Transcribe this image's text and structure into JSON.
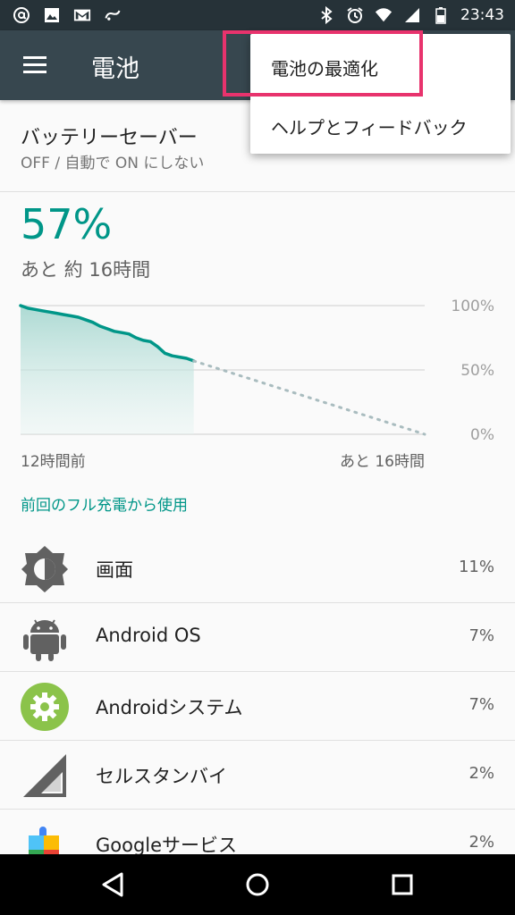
{
  "status_bar": {
    "time": "23:43",
    "left_icons": [
      "at-sign-icon",
      "image-icon",
      "gmail-icon",
      "voicemail-icon"
    ],
    "right_icons": [
      "bluetooth-icon",
      "alarm-icon",
      "wifi-icon",
      "signal-icon",
      "battery-icon"
    ]
  },
  "toolbar": {
    "title": "電池",
    "menu_icon": "hamburger-menu-icon",
    "background": "#37474f"
  },
  "overflow_menu": {
    "items": [
      {
        "label": "電池の最適化",
        "highlighted": true
      },
      {
        "label": "ヘルプとフィードバック"
      }
    ],
    "highlight_color": "#e8336d"
  },
  "battery_saver": {
    "title": "バッテリーセーバー",
    "subtitle": "OFF / 自動で ON にしない"
  },
  "battery": {
    "percent": "57%",
    "remaining": "あと 約 16時間"
  },
  "chart_data": {
    "type": "line",
    "y_ticks": [
      "100%",
      "50%",
      "0%"
    ],
    "x_labels": [
      "12時間前",
      "あと 16時間"
    ],
    "ylim": [
      0,
      100
    ],
    "accent": "#009688",
    "series": [
      {
        "kind": "actual",
        "x": [
          0,
          0.5,
          1,
          1.5,
          2,
          2.5,
          3,
          3.5,
          4,
          4.5,
          5,
          5.5,
          6,
          6.5,
          7,
          7.5,
          8,
          8.5,
          9,
          9.5,
          10,
          10.5,
          11,
          11.5,
          12
        ],
        "values": [
          100,
          98,
          97,
          96,
          95,
          94,
          93,
          92,
          91,
          89,
          87,
          84,
          82,
          80,
          79,
          78,
          75,
          73,
          72,
          68,
          63,
          61,
          60,
          59,
          57
        ]
      },
      {
        "kind": "projected",
        "x": [
          12,
          28
        ],
        "values": [
          57,
          0
        ]
      }
    ]
  },
  "usage_section": {
    "header": "前回のフル充電から使用",
    "items": [
      {
        "label": "画面",
        "percent": "11%",
        "icon": "brightness-icon"
      },
      {
        "label": "Android OS",
        "percent": "7%",
        "icon": "android-robot-icon"
      },
      {
        "label": "Androidシステム",
        "percent": "7%",
        "icon": "android-system-gear-icon"
      },
      {
        "label": "セルスタンバイ",
        "percent": "2%",
        "icon": "cell-signal-icon"
      },
      {
        "label": "Googleサービス",
        "percent": "2%",
        "icon": "google-services-puzzle-icon"
      }
    ]
  },
  "nav_bar": {
    "buttons": [
      "back-icon",
      "home-icon",
      "recents-icon"
    ]
  }
}
